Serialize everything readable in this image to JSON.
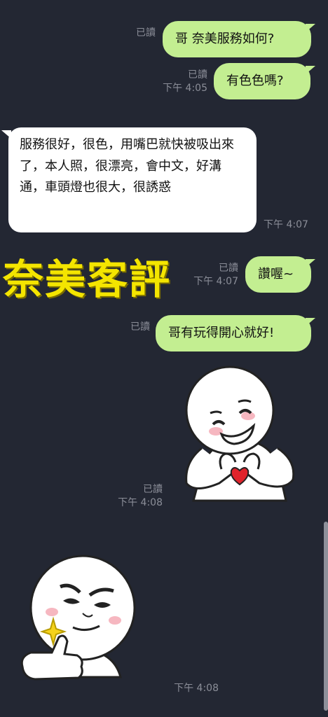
{
  "read_label": "已讀",
  "messages": {
    "m1": {
      "text": "哥 奈美服務如何?",
      "read": "已讀"
    },
    "m2": {
      "text": "有色色嗎?",
      "read": "已讀",
      "time": "下午 4:05"
    },
    "m3": {
      "text": "服務很好，很色，用嘴巴就快被吸出來了，本人照，很漂亮，會中文，好溝通，車頭燈也很大，很誘惑",
      "time": "下午 4:07"
    },
    "m4": {
      "text": "讚喔~",
      "read": "已讀",
      "time": "下午 4:07"
    },
    "m5": {
      "text": "哥有玩得開心就好!",
      "read": "已讀"
    },
    "m6": {
      "read": "已讀",
      "time": "下午 4:08"
    },
    "m7": {
      "time": "下午 4:08"
    }
  },
  "overlay": {
    "title": "奈美客評"
  },
  "colors": {
    "background": "#232733",
    "outgoing_bubble": "#c3ee91",
    "incoming_bubble": "#ffffff",
    "meta_text": "#8b8e98",
    "overlay_title": "#f4e500"
  },
  "stickers": [
    "heart-hands-sticker",
    "thumbs-up-sticker"
  ]
}
